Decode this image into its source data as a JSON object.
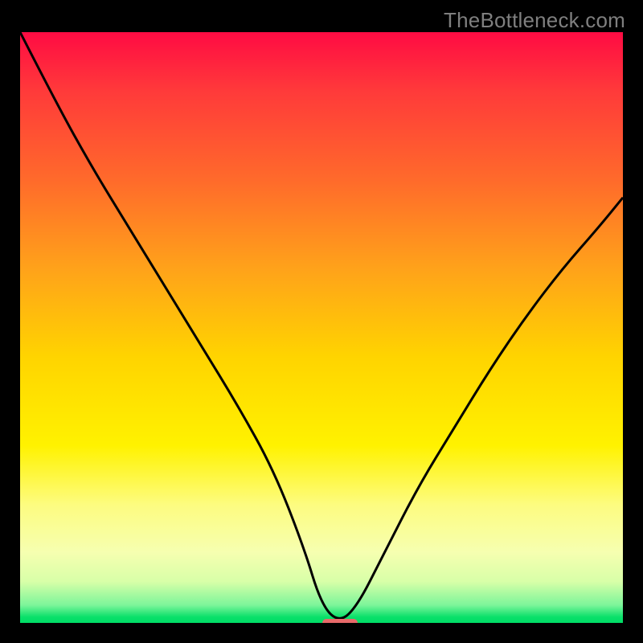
{
  "watermark": "TheBottleneck.com",
  "chart_data": {
    "type": "line",
    "title": "",
    "xlabel": "",
    "ylabel": "",
    "xlim": [
      0,
      100
    ],
    "ylim": [
      0,
      100
    ],
    "grid": false,
    "legend": false,
    "background_gradient": {
      "direction": "vertical",
      "stops": [
        {
          "pos": 0,
          "color": "#ff0b43"
        },
        {
          "pos": 10,
          "color": "#ff3a3a"
        },
        {
          "pos": 25,
          "color": "#ff6a2b"
        },
        {
          "pos": 40,
          "color": "#ffa21a"
        },
        {
          "pos": 55,
          "color": "#ffd400"
        },
        {
          "pos": 70,
          "color": "#fff200"
        },
        {
          "pos": 80,
          "color": "#fdfc80"
        },
        {
          "pos": 88,
          "color": "#f6ffb0"
        },
        {
          "pos": 93,
          "color": "#d8ffa8"
        },
        {
          "pos": 97,
          "color": "#7cf59a"
        },
        {
          "pos": 99,
          "color": "#0ae06a"
        },
        {
          "pos": 100,
          "color": "#00dd66"
        }
      ]
    },
    "series": [
      {
        "name": "bottleneck-curve",
        "color": "#000000",
        "x": [
          0,
          6,
          12,
          18,
          24,
          30,
          36,
          42,
          47,
          50,
          53,
          56,
          60,
          66,
          72,
          78,
          84,
          90,
          96,
          100
        ],
        "y": [
          100,
          88,
          77,
          67,
          57,
          47,
          37,
          26,
          13,
          3,
          0,
          3,
          11,
          23,
          33,
          43,
          52,
          60,
          67,
          72
        ]
      }
    ],
    "marker": {
      "name": "optimal-marker",
      "x": 53,
      "y": 0,
      "color": "#e86a6a"
    }
  }
}
